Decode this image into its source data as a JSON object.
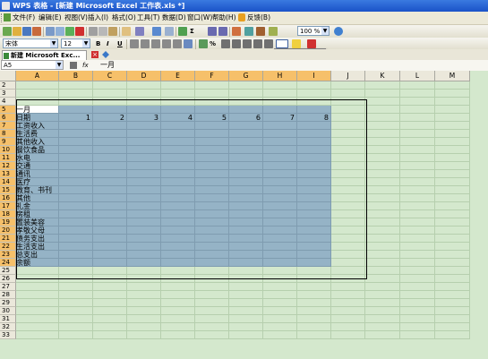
{
  "window": {
    "title": "WPS 表格 - [新建 Microsoft Excel 工作表.xls *]"
  },
  "menu": [
    "文件(F)",
    "编辑(E)",
    "视图(V)",
    "插入(I)",
    "格式(O)",
    "工具(T)",
    "数据(D)",
    "窗口(W)",
    "帮助(H)",
    "反馈(B)"
  ],
  "toolbar": {
    "zoom": "100 %",
    "font": "宋体",
    "size": "12",
    "bold": "B",
    "italic": "I",
    "underline": "U",
    "sigma": "Σ",
    "percent": "%"
  },
  "tab": {
    "label": "新建 Microsoft Exc...",
    "close": "×"
  },
  "formula_bar": {
    "cell_ref": "A5",
    "fx": "fx",
    "value": "一月"
  },
  "grid": {
    "columns": [
      "A",
      "B",
      "C",
      "D",
      "E",
      "F",
      "G",
      "H",
      "I",
      "J",
      "K",
      "L",
      "M"
    ],
    "selected_columns": [
      "A",
      "B",
      "C",
      "D",
      "E",
      "F",
      "G",
      "H",
      "I"
    ],
    "rows": [
      {
        "n": "2",
        "a": ""
      },
      {
        "n": "3",
        "a": ""
      },
      {
        "n": "4",
        "a": ""
      },
      {
        "n": "5",
        "a": "一月"
      },
      {
        "n": "6",
        "a": "日期"
      },
      {
        "n": "7",
        "a": "工资收入"
      },
      {
        "n": "8",
        "a": "生活费"
      },
      {
        "n": "9",
        "a": "其他收入"
      },
      {
        "n": "10",
        "a": "餐饮食品"
      },
      {
        "n": "11",
        "a": "水电"
      },
      {
        "n": "12",
        "a": "交通"
      },
      {
        "n": "13",
        "a": "通讯"
      },
      {
        "n": "14",
        "a": "医疗"
      },
      {
        "n": "15",
        "a": "教育、书刊"
      },
      {
        "n": "16",
        "a": "其他"
      },
      {
        "n": "17",
        "a": "礼金"
      },
      {
        "n": "18",
        "a": "房租"
      },
      {
        "n": "19",
        "a": "置装美容"
      },
      {
        "n": "20",
        "a": "孝敬父母"
      },
      {
        "n": "21",
        "a": "债务支出"
      },
      {
        "n": "22",
        "a": "生活支出"
      },
      {
        "n": "23",
        "a": "总支出"
      },
      {
        "n": "24",
        "a": "余额"
      },
      {
        "n": "25",
        "a": ""
      },
      {
        "n": "26",
        "a": ""
      },
      {
        "n": "27",
        "a": ""
      },
      {
        "n": "28",
        "a": ""
      },
      {
        "n": "29",
        "a": ""
      },
      {
        "n": "30",
        "a": ""
      },
      {
        "n": "31",
        "a": ""
      },
      {
        "n": "32",
        "a": ""
      },
      {
        "n": "33",
        "a": ""
      }
    ],
    "date_numbers": [
      "1",
      "2",
      "3",
      "4",
      "5",
      "6",
      "7",
      "8"
    ]
  }
}
